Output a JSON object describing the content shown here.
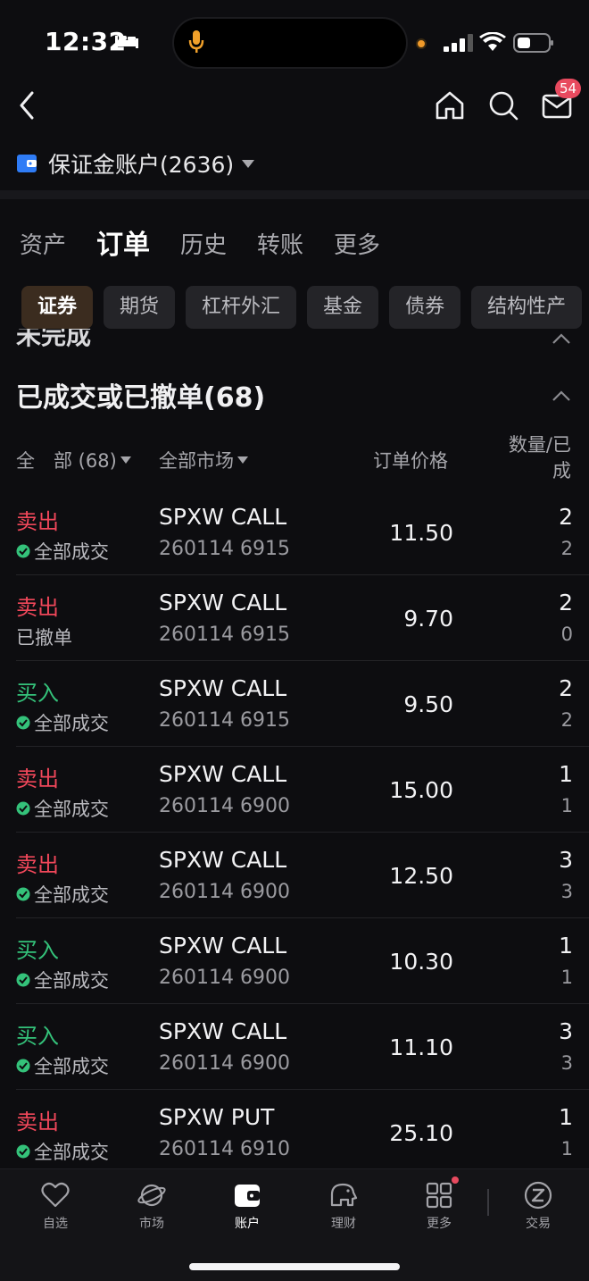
{
  "status_bar": {
    "time": "12:32"
  },
  "nav": {
    "mail_badge": "54"
  },
  "account": {
    "name": "保证金账户(2636)"
  },
  "top_tabs": [
    {
      "label": "资产"
    },
    {
      "label": "订单"
    },
    {
      "label": "历史"
    },
    {
      "label": "转账"
    },
    {
      "label": "更多"
    }
  ],
  "chips": [
    {
      "label": "证券"
    },
    {
      "label": "期货"
    },
    {
      "label": "杠杆外汇"
    },
    {
      "label": "基金"
    },
    {
      "label": "债券"
    },
    {
      "label": "结构性产"
    }
  ],
  "collapsed_section": {
    "title": "未完成"
  },
  "section": {
    "title": "已成交或已撤单(68)"
  },
  "table_header": {
    "filter": "全　部 (68)",
    "market": "全部市场",
    "price": "订单价格",
    "qty_line1": "数量/已",
    "qty_line2": "成"
  },
  "orders": [
    {
      "side": "卖出",
      "status": "全部成交",
      "symbol": "SPXW CALL",
      "code": "260114 6915",
      "price": "11.50",
      "qty": "2",
      "filled": "2"
    },
    {
      "side": "卖出",
      "status": "已撤单",
      "symbol": "SPXW CALL",
      "code": "260114 6915",
      "price": "9.70",
      "qty": "2",
      "filled": "0"
    },
    {
      "side": "买入",
      "status": "全部成交",
      "symbol": "SPXW CALL",
      "code": "260114 6915",
      "price": "9.50",
      "qty": "2",
      "filled": "2"
    },
    {
      "side": "卖出",
      "status": "全部成交",
      "symbol": "SPXW CALL",
      "code": "260114 6900",
      "price": "15.00",
      "qty": "1",
      "filled": "1"
    },
    {
      "side": "卖出",
      "status": "全部成交",
      "symbol": "SPXW CALL",
      "code": "260114 6900",
      "price": "12.50",
      "qty": "3",
      "filled": "3"
    },
    {
      "side": "买入",
      "status": "全部成交",
      "symbol": "SPXW CALL",
      "code": "260114 6900",
      "price": "10.30",
      "qty": "1",
      "filled": "1"
    },
    {
      "side": "买入",
      "status": "全部成交",
      "symbol": "SPXW CALL",
      "code": "260114 6900",
      "price": "11.10",
      "qty": "3",
      "filled": "3"
    },
    {
      "side": "卖出",
      "status": "全部成交",
      "symbol": "SPXW PUT",
      "code": "260114 6910",
      "price": "25.10",
      "qty": "1",
      "filled": "1"
    }
  ],
  "bottom_nav": [
    {
      "label": "自选"
    },
    {
      "label": "市场"
    },
    {
      "label": "账户"
    },
    {
      "label": "理财"
    },
    {
      "label": "更多"
    },
    {
      "label": "交易"
    }
  ],
  "colors": {
    "sell": "#f0475a",
    "buy": "#34c27a",
    "accent": "#f27b2a",
    "badge": "#e84a5f"
  }
}
